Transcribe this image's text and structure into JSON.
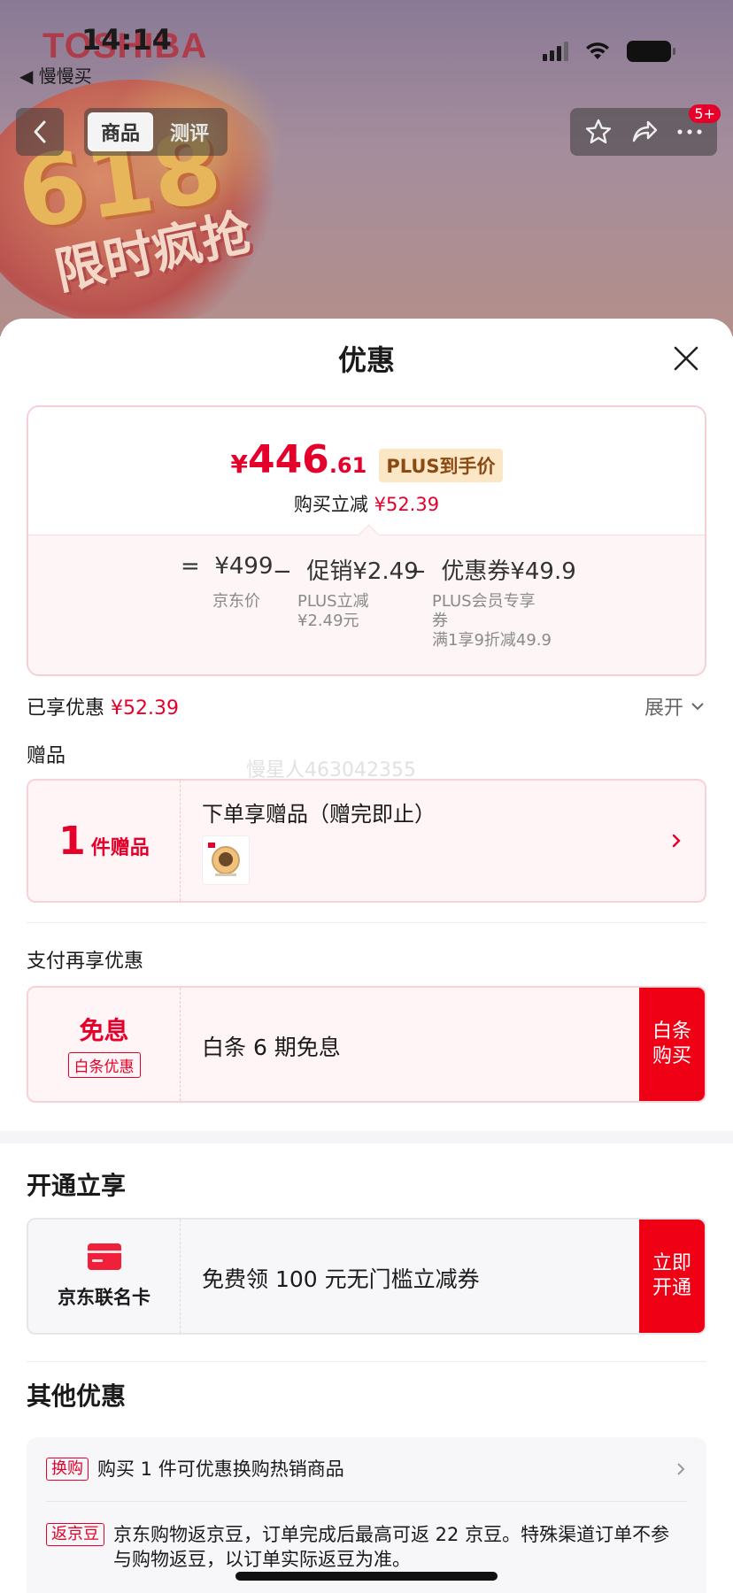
{
  "status_bar": {
    "time": "14:14",
    "back_app": "◀ 慢慢买"
  },
  "background": {
    "brand": "TOSHIBA",
    "promo_num": "618",
    "promo_text": "限时疯抢"
  },
  "nav": {
    "tabs": [
      {
        "label": "商品",
        "active": true
      },
      {
        "label": "测评",
        "active": false
      }
    ],
    "badge": "5+"
  },
  "sheet": {
    "title": "优惠",
    "price_card": {
      "currency": "¥",
      "price_int": "446",
      "price_dec": ".61",
      "plus_tag": "PLUS到手价",
      "subtitle_label": "购买立减",
      "subtitle_value": "¥52.39",
      "formula": [
        {
          "op": "=",
          "value": "¥499",
          "desc": "京东价"
        },
        {
          "op": "−",
          "value": "促销¥2.49",
          "desc": "PLUS立减\n¥2.49元"
        },
        {
          "op": "−",
          "value": "优惠券¥49.9",
          "desc": "PLUS会员专享\n券\n满1享9折减49.9"
        }
      ]
    },
    "enjoyed": {
      "label": "已享优惠",
      "value": "¥52.39",
      "expand": "展开"
    },
    "gift": {
      "section": "赠品",
      "watermark": "慢星人463042355",
      "count": "1",
      "count_label": "件赠品",
      "title": "下单享赠品（赠完即止）"
    },
    "pay": {
      "section": "支付再享优惠",
      "left_title": "免息",
      "left_tag": "白条优惠",
      "text": "白条 6 期免息",
      "action": "白条\n购买"
    },
    "open": {
      "section": "开通立享",
      "card_label": "京东联名卡",
      "text": "免费领 100 元无门槛立减券",
      "action": "立即\n开通"
    },
    "other": {
      "section": "其他优惠",
      "items": [
        {
          "tag": "换购",
          "text": "购买 1 件可优惠换购热销商品"
        },
        {
          "tag": "返京豆",
          "text": "京东购物返京豆，订单完成后最高可返 22 京豆。特殊渠道订单不参与购物返豆，以订单实际返豆为准。"
        }
      ]
    }
  },
  "colors": {
    "accent_red": "#e4002b",
    "action_red": "#f00014",
    "plus_gold": "#fbe6c6"
  }
}
